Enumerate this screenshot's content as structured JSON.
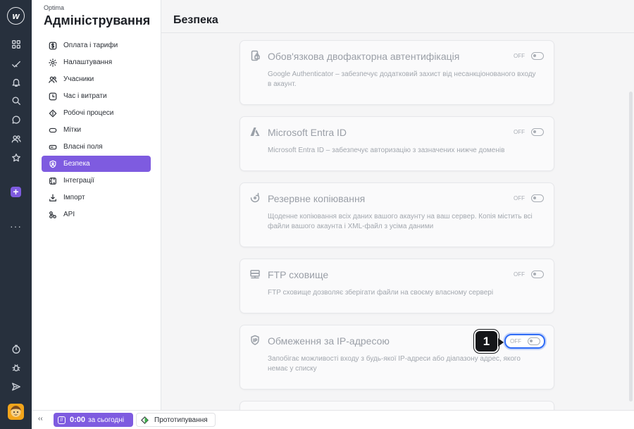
{
  "app": {
    "logo_letter": "w",
    "more_label": "···"
  },
  "sidebar": {
    "breadcrumb": "Optima",
    "title": "Адміністрування",
    "items": [
      {
        "label": "Оплата і тарифи",
        "icon": "dollar-icon",
        "active": false
      },
      {
        "label": "Налаштування",
        "icon": "gear-icon",
        "active": false
      },
      {
        "label": "Учасники",
        "icon": "users-icon",
        "active": false
      },
      {
        "label": "Час і витрати",
        "icon": "clock-icon",
        "active": false
      },
      {
        "label": "Робочі процеси",
        "icon": "workflow-icon",
        "active": false
      },
      {
        "label": "Мітки",
        "icon": "tag-icon",
        "active": false
      },
      {
        "label": "Власні поля",
        "icon": "field-icon",
        "active": false
      },
      {
        "label": "Безпека",
        "icon": "shield-icon",
        "active": true
      },
      {
        "label": "Інтеграції",
        "icon": "integration-icon",
        "active": false
      },
      {
        "label": "Імпорт",
        "icon": "import-icon",
        "active": false
      },
      {
        "label": "API",
        "icon": "api-icon",
        "active": false
      }
    ]
  },
  "main": {
    "title": "Безпека",
    "cards": [
      {
        "title": "Обов'язкова двофакторна автентифікація",
        "description": "Google Authenticator – забезпечує додатковий захист від несанкціонованого входу в акаунт.",
        "toggle": "OFF",
        "icon": "phone-lock-icon"
      },
      {
        "title": "Microsoft Entra ID",
        "description": "Microsoft Entra ID – забезпечує авторизацію з зазначених нижче доменів",
        "toggle": "OFF",
        "icon": "azure-icon"
      },
      {
        "title": "Резервне копіювання",
        "description": "Щоденне копіювання всіх даних вашого акаунту на ваш сервер. Копія містить всі файли вашого акаунта і XML-файл з усіма даними",
        "toggle": "OFF",
        "icon": "backup-icon"
      },
      {
        "title": "FTP сховище",
        "description": "FTP сховище дозволяє зберігати файли на своєму власному сервері",
        "toggle": "OFF",
        "icon": "server-icon"
      },
      {
        "title": "Обмеження за IP-адресою",
        "description": "Запобігає можливості входу з будь-якої IP-адреси або діапазону адрес, якого немає у списку",
        "toggle": "OFF",
        "icon": "ip-shield-icon"
      }
    ]
  },
  "callout": {
    "number": "1"
  },
  "bottombar": {
    "collapse": "‹‹",
    "timer_icon_glyph": "//",
    "timer_value": "0:00",
    "timer_label": "за сьогодні",
    "project_label": "Прототипування"
  },
  "colors": {
    "accent": "#7e5be0",
    "rail": "#27303d",
    "focus": "#2f6cf6"
  }
}
